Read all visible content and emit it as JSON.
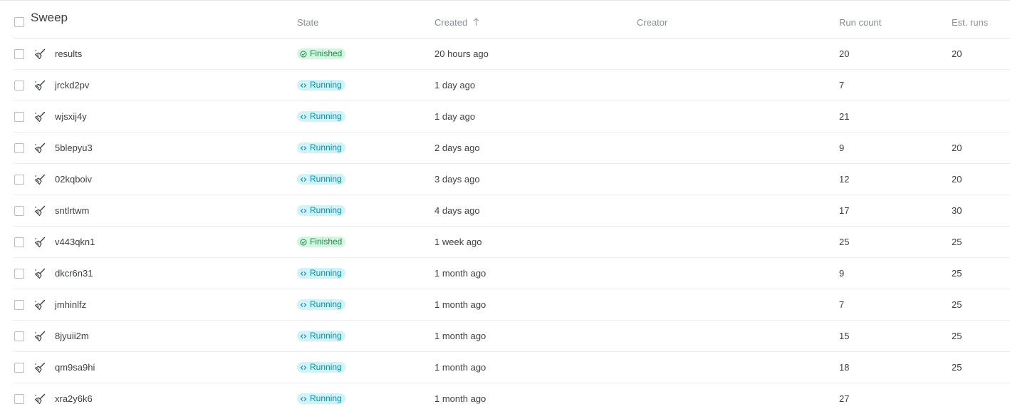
{
  "header": {
    "sweep": "Sweep",
    "state": "State",
    "created": "Created",
    "creator": "Creator",
    "run_count": "Run count",
    "est_runs": "Est. runs"
  },
  "sort": {
    "column": "created",
    "direction": "ascending",
    "icon": "arrow-up-icon"
  },
  "colors": {
    "finished_bg": "#d6f5e0",
    "finished_fg": "#1b8a4c",
    "running_bg": "#d3f2f7",
    "running_fg": "#0a8fa4"
  },
  "rows": [
    {
      "name": "results",
      "state": "Finished",
      "created": "20 hours ago",
      "run_count": "20",
      "est_runs": "20"
    },
    {
      "name": "jrckd2pv",
      "state": "Running",
      "created": "1 day ago",
      "run_count": "7",
      "est_runs": ""
    },
    {
      "name": "wjsxij4y",
      "state": "Running",
      "created": "1 day ago",
      "run_count": "21",
      "est_runs": ""
    },
    {
      "name": "5blepyu3",
      "state": "Running",
      "created": "2 days ago",
      "run_count": "9",
      "est_runs": "20"
    },
    {
      "name": "02kqboiv",
      "state": "Running",
      "created": "3 days ago",
      "run_count": "12",
      "est_runs": "20"
    },
    {
      "name": "sntlrtwm",
      "state": "Running",
      "created": "4 days ago",
      "run_count": "17",
      "est_runs": "30"
    },
    {
      "name": "v443qkn1",
      "state": "Finished",
      "created": "1 week ago",
      "run_count": "25",
      "est_runs": "25"
    },
    {
      "name": "dkcr6n31",
      "state": "Running",
      "created": "1 month ago",
      "run_count": "9",
      "est_runs": "25"
    },
    {
      "name": "jmhinlfz",
      "state": "Running",
      "created": "1 month ago",
      "run_count": "7",
      "est_runs": "25"
    },
    {
      "name": "8jyuii2m",
      "state": "Running",
      "created": "1 month ago",
      "run_count": "15",
      "est_runs": "25"
    },
    {
      "name": "qm9sa9hi",
      "state": "Running",
      "created": "1 month ago",
      "run_count": "18",
      "est_runs": "25"
    },
    {
      "name": "xra2y6k6",
      "state": "Running",
      "created": "1 month ago",
      "run_count": "27",
      "est_runs": ""
    }
  ]
}
